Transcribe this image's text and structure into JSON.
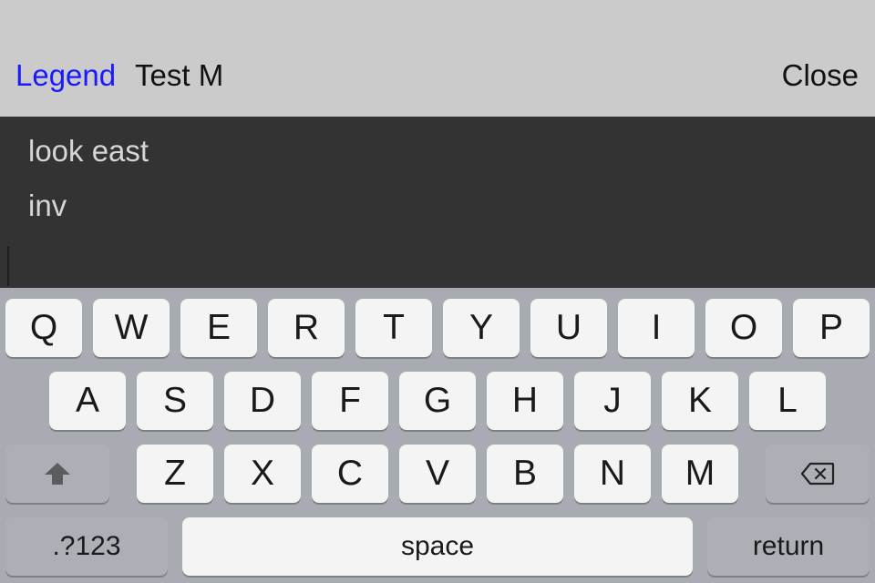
{
  "navbar": {
    "legend_label": "Legend",
    "title": "Test M",
    "close_label": "Close"
  },
  "terminal": {
    "lines": [
      "look east",
      "inv"
    ],
    "input_value": ""
  },
  "keyboard": {
    "row1": [
      "Q",
      "W",
      "E",
      "R",
      "T",
      "Y",
      "U",
      "I",
      "O",
      "P"
    ],
    "row2": [
      "A",
      "S",
      "D",
      "F",
      "G",
      "H",
      "J",
      "K",
      "L"
    ],
    "row3": [
      "Z",
      "X",
      "C",
      "V",
      "B",
      "N",
      "M"
    ],
    "shift_icon": "shift-arrow-icon",
    "delete_icon": "backspace-icon",
    "numbers_label": ".?123",
    "space_label": "space",
    "return_label": "return"
  },
  "colors": {
    "navbar_bg": "#cbcbcb",
    "accent": "#1a1aff",
    "terminal_bg": "#333333",
    "terminal_text": "#d6d6d6",
    "keyboard_bg": "#a8abb1",
    "key_bg": "#f4f4f4",
    "key_dark_bg": "#acb0b6"
  }
}
